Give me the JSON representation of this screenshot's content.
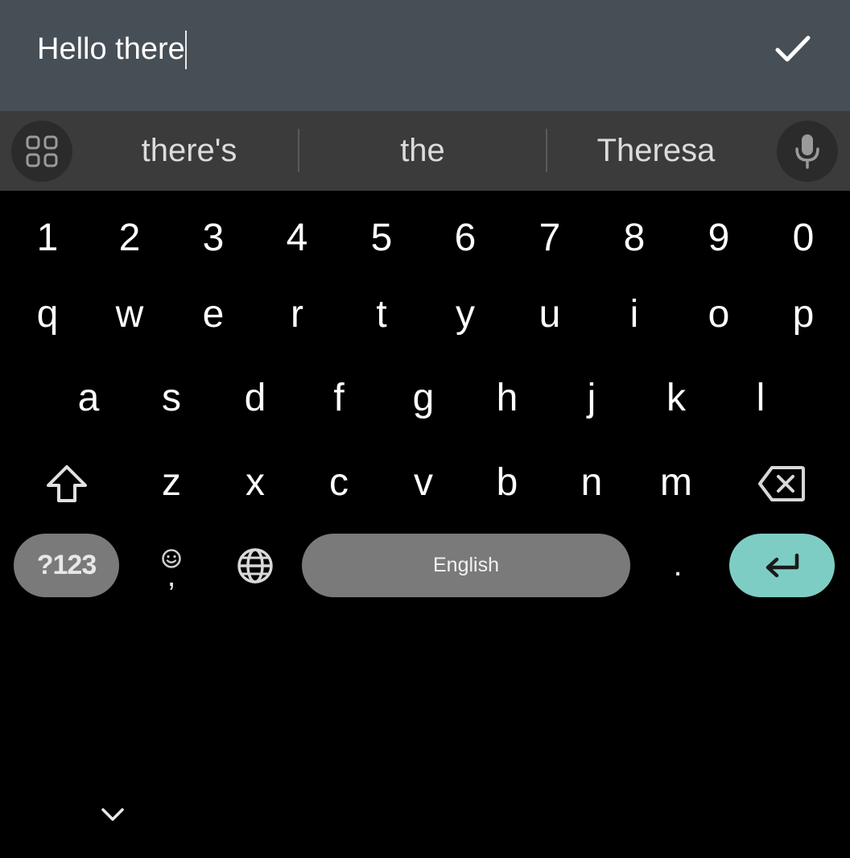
{
  "input": {
    "value": "Hello there"
  },
  "suggestions": {
    "items": [
      "there's",
      "the",
      "Theresa"
    ]
  },
  "keyboard": {
    "numbers": [
      "1",
      "2",
      "3",
      "4",
      "5",
      "6",
      "7",
      "8",
      "9",
      "0"
    ],
    "row1": [
      "q",
      "w",
      "e",
      "r",
      "t",
      "y",
      "u",
      "i",
      "o",
      "p"
    ],
    "row2": [
      "a",
      "s",
      "d",
      "f",
      "g",
      "h",
      "j",
      "k",
      "l"
    ],
    "row3": [
      "z",
      "x",
      "c",
      "v",
      "b",
      "n",
      "m"
    ],
    "symbols_label": "?123",
    "comma_label": ",",
    "space_label": "English",
    "period_label": "."
  },
  "icons": {
    "done": "checkmark-icon",
    "apps": "apps-grid-icon",
    "mic": "microphone-icon",
    "shift": "shift-icon",
    "backspace": "backspace-icon",
    "emoji": "emoji-icon",
    "globe": "globe-icon",
    "enter": "enter-icon",
    "collapse": "chevron-down-icon"
  },
  "colors": {
    "input_bar": "#474f56",
    "suggestion_bar": "#3b3b3b",
    "keyboard_bg": "#000000",
    "key_pill": "#7a7a7a",
    "enter_accent": "#7ecdc4"
  }
}
